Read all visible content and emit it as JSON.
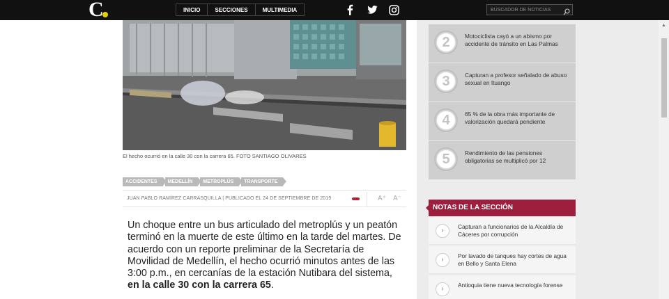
{
  "header": {
    "logo": "C",
    "nav": [
      "INICIO",
      "SECCIONES",
      "MULTIMEDIA"
    ],
    "social": [
      "facebook-icon",
      "twitter-icon",
      "instagram-icon"
    ],
    "search_placeholder": "BUSCADOR DE NOTICIAS"
  },
  "article": {
    "photo_caption": "El hecho ocurrió en la calle 30 con la carrera 65. FOTO SANTIAGO OLIVARES",
    "tags": [
      "ACCIDENTES",
      "MEDELLÍN",
      "METROPLÚS",
      "TRANSPORTE"
    ],
    "byline": "JUAN PABLO RAMÍREZ CARRASQUILLA | PUBLICADO EL 24 DE SEPTIEMBRE DE 2019",
    "font_increase": "A⁺",
    "font_decrease": "A⁻",
    "lead_text": "Un choque entre un bus articulado del metroplús y un peatón terminó en la muerte de este último en la tarde del martes. De acuerdo con un reporte preliminar de la Secretaría de Movilidad de Medellín, el hecho ocurrió minutos antes de las 3:00 p.m., en cercanías de la estación Nutibara del sistema, ",
    "lead_bold": "en la calle 30 con la carrera 65",
    "lead_end": "."
  },
  "sidebar": {
    "popular": [
      {
        "num": "2",
        "text": "Motociclista cayó a un abismo por accidente de tránsito en Las Palmas"
      },
      {
        "num": "3",
        "text": "Capturan a profesor señalado de abuso sexual en Ituango"
      },
      {
        "num": "4",
        "text": "65 % de la obra más importante de valorización quedará pendiente"
      },
      {
        "num": "5",
        "text": "Rendimiento de las pensiones obligatorias se multiplicó por 12"
      }
    ],
    "section_title": "NOTAS DE LA SECCIÓN",
    "notes": [
      "Capturan a funcionarios de la Alcaldía de Cáceres por corrupción",
      "Por lavado de tanques hay cortes de agua en Bello y Santa Elena",
      "Antioquia tiene nueva tecnología forense"
    ]
  }
}
